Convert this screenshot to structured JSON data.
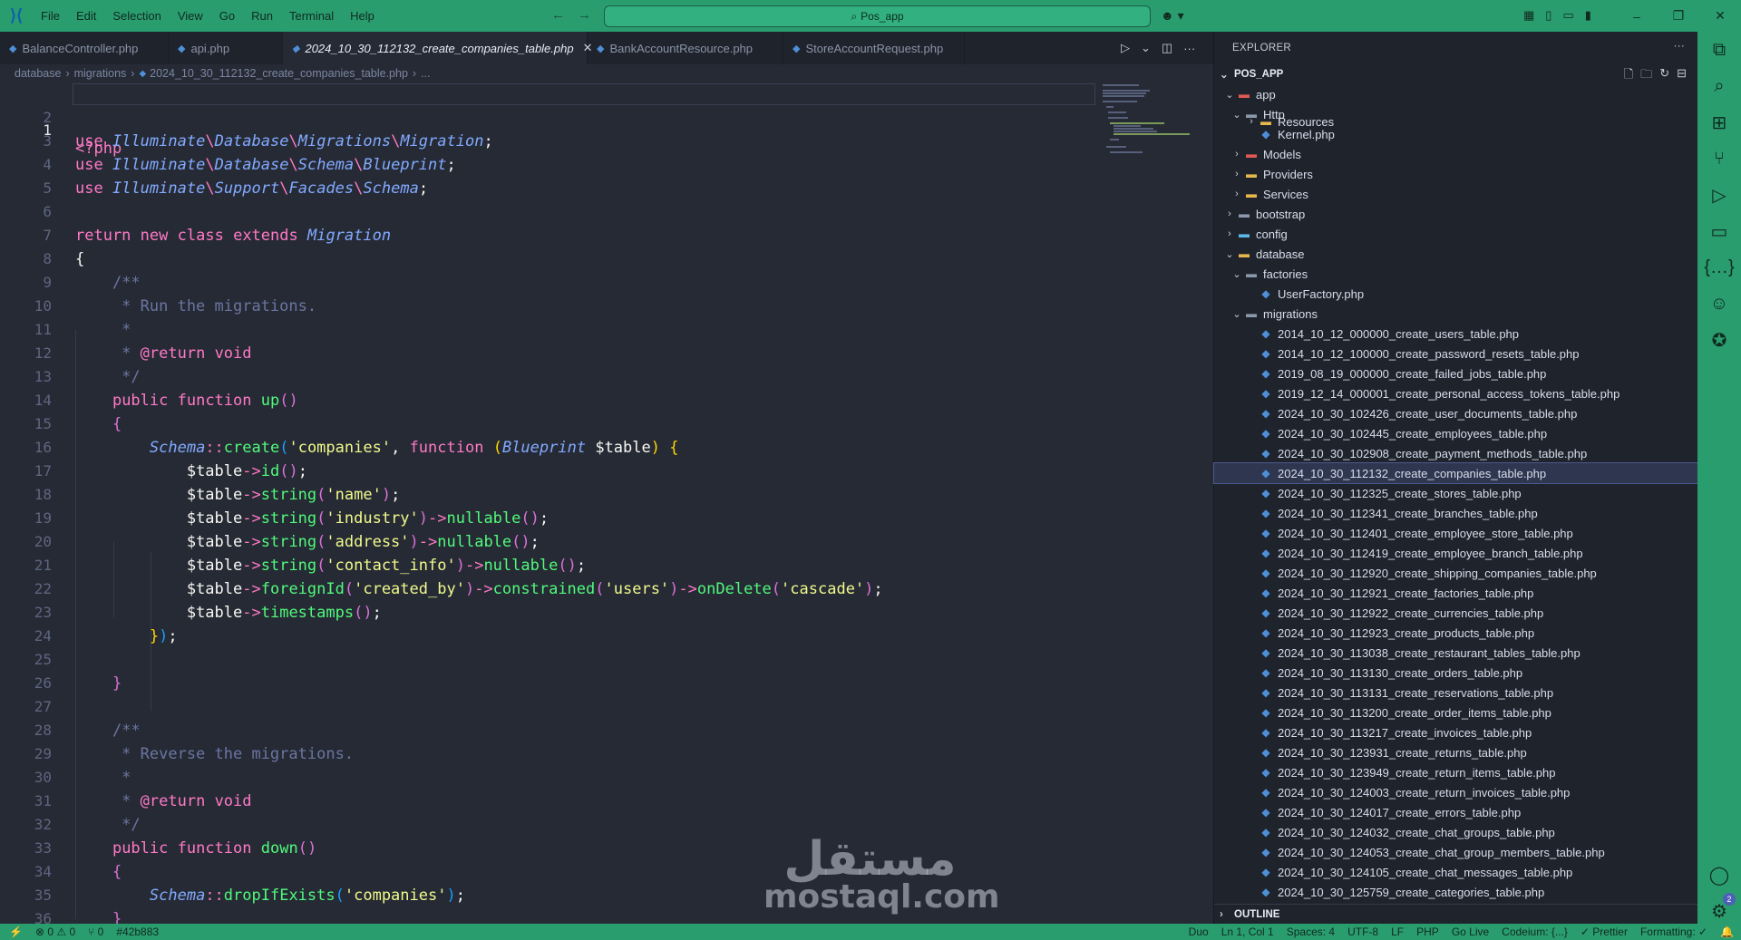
{
  "titlebar": {
    "menu": [
      "File",
      "Edit",
      "Selection",
      "View",
      "Go",
      "Run",
      "Terminal",
      "Help"
    ],
    "search_text": "Pos_app",
    "back_icon": "arrow-left-icon",
    "forward_icon": "arrow-right-icon",
    "accent_color": "#2a9d6f"
  },
  "tabs": [
    {
      "label": "BalanceController.php",
      "active": false
    },
    {
      "label": "api.php",
      "active": false
    },
    {
      "label": "2024_10_30_112132_create_companies_table.php",
      "active": true
    },
    {
      "label": "BankAccountResource.php",
      "active": false
    },
    {
      "label": "StoreAccountRequest.php",
      "active": false
    }
  ],
  "breadcrumb": {
    "items": [
      "database",
      "migrations",
      "2024_10_30_112132_create_companies_table.php",
      "..."
    ]
  },
  "editor": {
    "line_numbers": [
      "1",
      "2",
      "3",
      "4",
      "5",
      "6",
      "7",
      "8",
      "9",
      "10",
      "11",
      "12",
      "13",
      "14",
      "15",
      "16",
      "17",
      "18",
      "19",
      "20",
      "21",
      "22",
      "23",
      "24",
      "25",
      "26",
      "27",
      "28",
      "29",
      "30",
      "31",
      "32",
      "33",
      "34",
      "35",
      "36"
    ],
    "current_line": "1"
  },
  "explorer": {
    "title": "EXPLORER",
    "project": "POS_APP",
    "tree": [
      {
        "label": "app",
        "kind": "folder-red",
        "open": true,
        "depth": 1
      },
      {
        "label": "Http",
        "kind": "folder-grey",
        "open": true,
        "depth": 2
      },
      {
        "label": "Resources",
        "kind": "folder",
        "open": false,
        "depth": 3,
        "clipped": true
      },
      {
        "label": "Kernel.php",
        "kind": "php",
        "depth": 3
      },
      {
        "label": "Models",
        "kind": "folder-red",
        "open": false,
        "depth": 2
      },
      {
        "label": "Providers",
        "kind": "folder",
        "open": false,
        "depth": 2
      },
      {
        "label": "Services",
        "kind": "folder",
        "open": false,
        "depth": 2
      },
      {
        "label": "bootstrap",
        "kind": "folder-grey",
        "open": false,
        "depth": 1
      },
      {
        "label": "config",
        "kind": "folder-blue",
        "open": false,
        "depth": 1
      },
      {
        "label": "database",
        "kind": "folder",
        "open": true,
        "depth": 1
      },
      {
        "label": "factories",
        "kind": "folder-grey",
        "open": true,
        "depth": 2
      },
      {
        "label": "UserFactory.php",
        "kind": "php",
        "depth": 3
      },
      {
        "label": "migrations",
        "kind": "folder-grey",
        "open": true,
        "depth": 2
      },
      {
        "label": "2014_10_12_000000_create_users_table.php",
        "kind": "php",
        "depth": 3
      },
      {
        "label": "2014_10_12_100000_create_password_resets_table.php",
        "kind": "php",
        "depth": 3
      },
      {
        "label": "2019_08_19_000000_create_failed_jobs_table.php",
        "kind": "php",
        "depth": 3
      },
      {
        "label": "2019_12_14_000001_create_personal_access_tokens_table.php",
        "kind": "php",
        "depth": 3
      },
      {
        "label": "2024_10_30_102426_create_user_documents_table.php",
        "kind": "php",
        "depth": 3
      },
      {
        "label": "2024_10_30_102445_create_employees_table.php",
        "kind": "php",
        "depth": 3
      },
      {
        "label": "2024_10_30_102908_create_payment_methods_table.php",
        "kind": "php",
        "depth": 3
      },
      {
        "label": "2024_10_30_112132_create_companies_table.php",
        "kind": "php",
        "depth": 3,
        "selected": true
      },
      {
        "label": "2024_10_30_112325_create_stores_table.php",
        "kind": "php",
        "depth": 3
      },
      {
        "label": "2024_10_30_112341_create_branches_table.php",
        "kind": "php",
        "depth": 3
      },
      {
        "label": "2024_10_30_112401_create_employee_store_table.php",
        "kind": "php",
        "depth": 3
      },
      {
        "label": "2024_10_30_112419_create_employee_branch_table.php",
        "kind": "php",
        "depth": 3
      },
      {
        "label": "2024_10_30_112920_create_shipping_companies_table.php",
        "kind": "php",
        "depth": 3
      },
      {
        "label": "2024_10_30_112921_create_factories_table.php",
        "kind": "php",
        "depth": 3
      },
      {
        "label": "2024_10_30_112922_create_currencies_table.php",
        "kind": "php",
        "depth": 3
      },
      {
        "label": "2024_10_30_112923_create_products_table.php",
        "kind": "php",
        "depth": 3
      },
      {
        "label": "2024_10_30_113038_create_restaurant_tables_table.php",
        "kind": "php",
        "depth": 3
      },
      {
        "label": "2024_10_30_113130_create_orders_table.php",
        "kind": "php",
        "depth": 3
      },
      {
        "label": "2024_10_30_113131_create_reservations_table.php",
        "kind": "php",
        "depth": 3
      },
      {
        "label": "2024_10_30_113200_create_order_items_table.php",
        "kind": "php",
        "depth": 3
      },
      {
        "label": "2024_10_30_113217_create_invoices_table.php",
        "kind": "php",
        "depth": 3
      },
      {
        "label": "2024_10_30_123931_create_returns_table.php",
        "kind": "php",
        "depth": 3
      },
      {
        "label": "2024_10_30_123949_create_return_items_table.php",
        "kind": "php",
        "depth": 3
      },
      {
        "label": "2024_10_30_124003_create_return_invoices_table.php",
        "kind": "php",
        "depth": 3
      },
      {
        "label": "2024_10_30_124017_create_errors_table.php",
        "kind": "php",
        "depth": 3
      },
      {
        "label": "2024_10_30_124032_create_chat_groups_table.php",
        "kind": "php",
        "depth": 3
      },
      {
        "label": "2024_10_30_124053_create_chat_group_members_table.php",
        "kind": "php",
        "depth": 3
      },
      {
        "label": "2024_10_30_124105_create_chat_messages_table.php",
        "kind": "php",
        "depth": 3
      },
      {
        "label": "2024_10_30_125759_create_categories_table.php",
        "kind": "php",
        "depth": 3,
        "clipped": true
      }
    ],
    "outline": "OUTLINE"
  },
  "statusbar": {
    "remote": "⚡",
    "problems": "⊗ 0 ⚠ 0",
    "ports": "⑂ 0",
    "commit": "#42b883",
    "theme": "Duo",
    "position": "Ln 1, Col 1",
    "spaces": "Spaces: 4",
    "encoding": "UTF-8",
    "eol": "LF",
    "language": "PHP",
    "golive": "Go Live",
    "codeium": "Codeium: {...}",
    "prettier": "✓ Prettier",
    "formatting": "Formatting: ✓",
    "bell": "bell-icon"
  },
  "activity_badge": "2",
  "watermark": {
    "arabic": "مستقل",
    "latin": "mostaql.com"
  }
}
